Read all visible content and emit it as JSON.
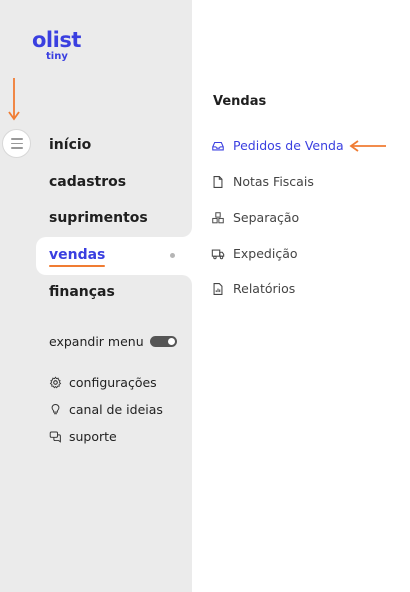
{
  "logo": {
    "main": "olist",
    "sub": "tiny"
  },
  "nav": {
    "items": [
      {
        "label": "início"
      },
      {
        "label": "cadastros"
      },
      {
        "label": "suprimentos"
      },
      {
        "label": "vendas"
      },
      {
        "label": "finanças"
      }
    ],
    "active_index": 3
  },
  "expand_menu": {
    "label": "expandir menu",
    "on": true
  },
  "utility": [
    {
      "label": "configurações",
      "icon": "gear-icon"
    },
    {
      "label": "canal de ideias",
      "icon": "lightbulb-icon"
    },
    {
      "label": "suporte",
      "icon": "chat-icon"
    }
  ],
  "panel": {
    "title": "Vendas",
    "items": [
      {
        "label": "Pedidos de Venda",
        "icon": "inbox-icon",
        "active": true
      },
      {
        "label": "Notas Fiscais",
        "icon": "document-icon"
      },
      {
        "label": "Separação",
        "icon": "boxes-icon"
      },
      {
        "label": "Expedição",
        "icon": "truck-icon"
      },
      {
        "label": "Relatórios",
        "icon": "report-icon"
      }
    ]
  },
  "colors": {
    "brand": "#3a3fe0",
    "accent": "#f07c33",
    "sidebar_bg": "#ebebeb"
  }
}
